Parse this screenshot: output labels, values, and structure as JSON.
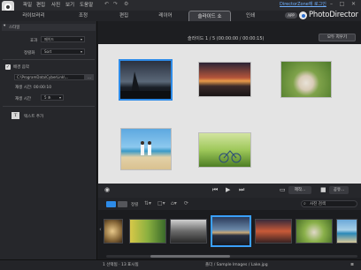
{
  "menubar": {
    "items": [
      "파일",
      "편집",
      "사진",
      "보기",
      "도움말"
    ],
    "director_zone": "DirectorZone에 로그인"
  },
  "tabs": [
    {
      "label": "라이브러리"
    },
    {
      "label": "조정"
    },
    {
      "label": "편집"
    },
    {
      "label": "레이어"
    },
    {
      "label": "슬라이드 쇼"
    },
    {
      "label": "인쇄"
    }
  ],
  "brand": {
    "badge": "APP",
    "name": "PhotoDirector"
  },
  "left_panel": {
    "style_header": "스타일",
    "effect_label": "효과",
    "effect_value": "페이드",
    "arrange_label": "정렬화",
    "arrange_value": "Sort",
    "bgm_label": "배경 음악",
    "bgm_checked": true,
    "bgm_path": "C:\\ProgramData\\CyberLink\\...",
    "bgm_path_button": "...",
    "music_duration": "재생 시간: 00:00:10",
    "slide_duration_label": "재생 시간",
    "slide_duration_value": "5 초",
    "add_text": "텍스트 추가"
  },
  "preview": {
    "counter": "슬라이드 1 / 5 (00:00:00 / 00:00:15)",
    "shuffle_label": "모두 지우기"
  },
  "transport": {
    "production_label": "제작...",
    "share_label": "공유..."
  },
  "filmstrip_toolbar": {
    "sort_label": "정렬",
    "search_placeholder": "사진 검색"
  },
  "status": {
    "selection": "1 선택됨 · 13 표시됨",
    "path": "폴더 / Sample Images / Lake.jpg"
  },
  "colors": {
    "accent": "#2d8be8",
    "brand_dot": "#2b6fd1",
    "share_button": "#b03030"
  }
}
